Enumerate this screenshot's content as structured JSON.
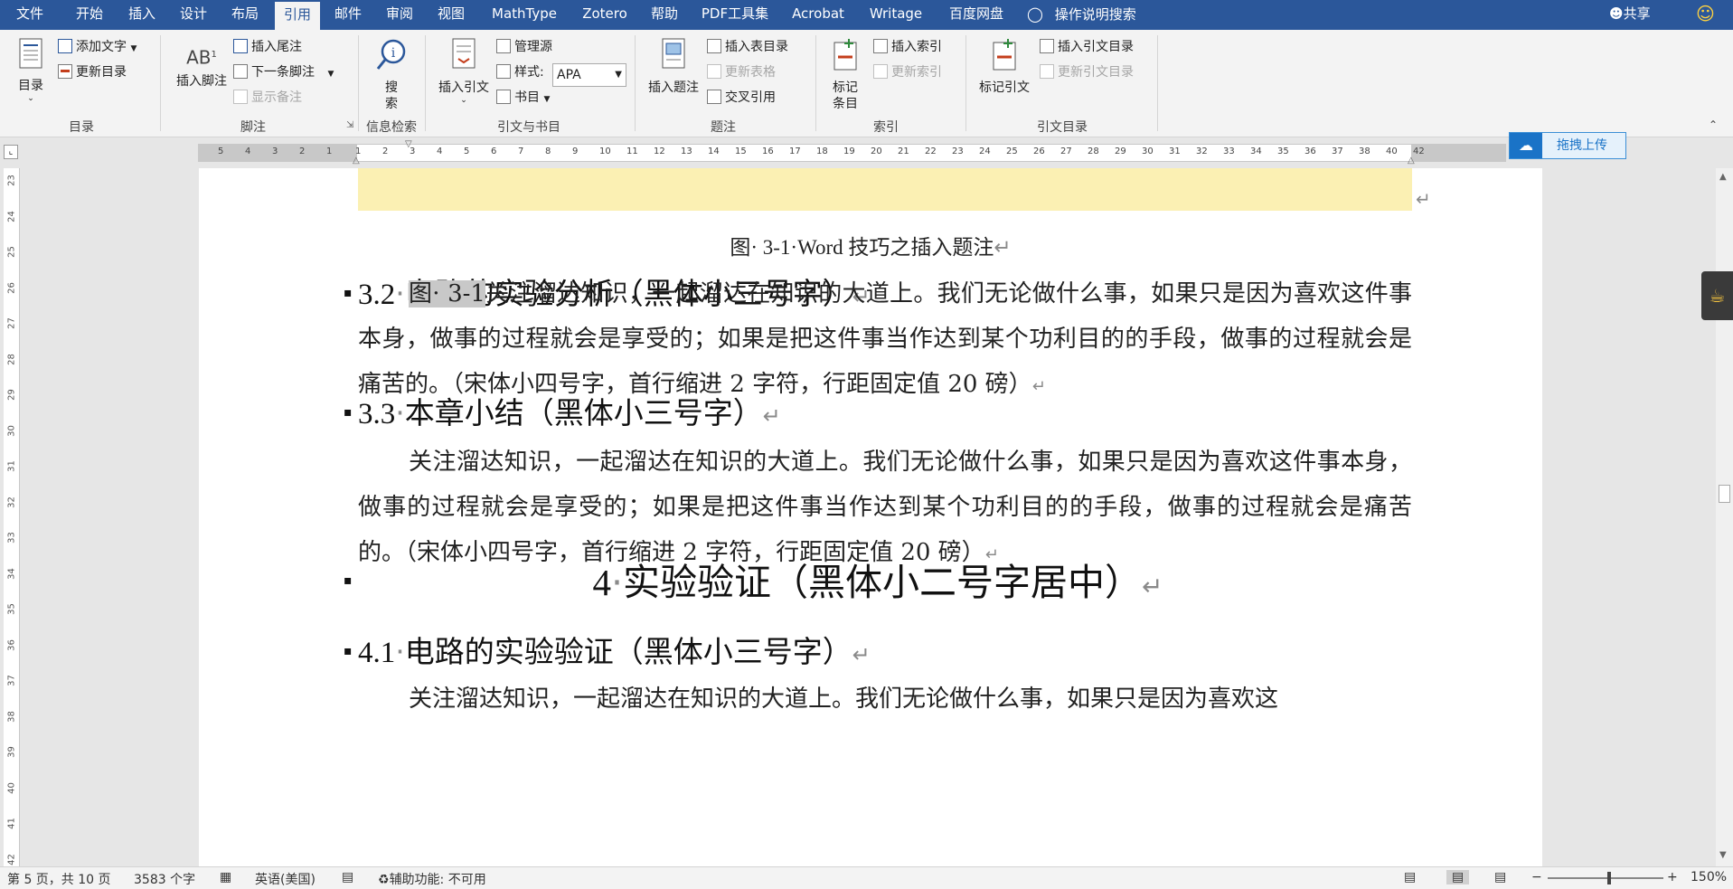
{
  "menubar": {
    "tabs": [
      "文件",
      "开始",
      "插入",
      "设计",
      "布局",
      "引用",
      "邮件",
      "审阅",
      "视图",
      "MathType",
      "Zotero",
      "帮助",
      "PDF工具集",
      "Acrobat",
      "Writage",
      "百度网盘"
    ],
    "active_tab": "引用",
    "tell_me": "操作说明搜索",
    "share": "共享"
  },
  "ribbon": {
    "toc": {
      "button": "目录",
      "add_text": "添加文字",
      "update_toc": "更新目录",
      "group": "目录"
    },
    "footnote": {
      "insert_footnote": "插入脚注",
      "insert_endnote": "插入尾注",
      "next_footnote": "下一条脚注",
      "show_notes": "显示备注",
      "group": "脚注"
    },
    "research": {
      "search_line1": "搜",
      "search_line2": "索",
      "group": "信息检索"
    },
    "citations": {
      "insert_citation": "插入引文",
      "manage_sources": "管理源",
      "style_label": "样式:",
      "style_value": "APA",
      "bibliography": "书目",
      "group": "引文与书目"
    },
    "captions": {
      "insert_caption": "插入题注",
      "insert_table_of_figures": "插入表目录",
      "update_table": "更新表格",
      "cross_reference": "交叉引用",
      "group": "题注"
    },
    "index": {
      "mark_entry_line1": "标记",
      "mark_entry_line2": "条目",
      "insert_index": "插入索引",
      "update_index": "更新索引",
      "group": "索引"
    },
    "authorities": {
      "mark_citation": "标记引文",
      "insert_toa": "插入引文目录",
      "update_toa": "更新引文目录",
      "group": "引文目录"
    }
  },
  "ruler": {
    "ticks": [
      "5",
      "4",
      "3",
      "2",
      "1",
      "1",
      "2",
      "3",
      "4",
      "5",
      "6",
      "7",
      "8",
      "9",
      "10",
      "11",
      "12",
      "13",
      "14",
      "15",
      "16",
      "17",
      "18",
      "19",
      "20",
      "21",
      "22",
      "23",
      "24",
      "25",
      "26",
      "27",
      "28",
      "29",
      "30",
      "31",
      "32",
      "33",
      "34",
      "35",
      "36",
      "37",
      "38",
      "40",
      "42"
    ],
    "vticks": [
      "23",
      "24",
      "25",
      "26",
      "27",
      "28",
      "29",
      "30",
      "31",
      "32",
      "33",
      "34",
      "35",
      "36",
      "37",
      "38",
      "39",
      "40",
      "41",
      "42"
    ]
  },
  "upload_button": "拖拽上传",
  "document": {
    "caption": "图· 3-1·Word 技巧之插入题注",
    "h32_num": "3.2",
    "h32_text": "电路的实验分析（黑体小三号字）",
    "p1_ref": "图· 3-1",
    "p1_text": "关注溜达知识，一起溜达在知识的大道上。我们无论做什么事，如果只是因为喜欢这件事本身，做事的过程就会是享受的；如果是把这件事当作达到某个功利目的的手段，做事的过程就会是痛苦的。（宋体小四号字，首行缩进 2 字符，行距固定值 20 磅）",
    "h33_num": "3.3",
    "h33_text": "本章小结（黑体小三号字）",
    "p2_text": "关注溜达知识，一起溜达在知识的大道上。我们无论做什么事，如果只是因为喜欢这件事本身，做事的过程就会是享受的；如果是把这件事当作达到某个功利目的的手段，做事的过程就会是痛苦的。（宋体小四号字，首行缩进 2 字符，行距固定值 20 磅）",
    "h4_num": "4",
    "h4_text": "实验验证（黑体小二号字居中）",
    "h41_num": "4.1",
    "h41_text": "电路的实验验证（黑体小三号字）",
    "p3_text": "关注溜达知识，一起溜达在知识的大道上。我们无论做什么事，如果只是因为喜欢这"
  },
  "statusbar": {
    "page": "第 5 页，共 10 页",
    "words": "3583 个字",
    "language": "英语(美国)",
    "accessibility": "辅助功能: 不可用",
    "zoom": "150%"
  },
  "colors": {
    "accent": "#2b579a",
    "highlight": "#fbf0b3"
  }
}
